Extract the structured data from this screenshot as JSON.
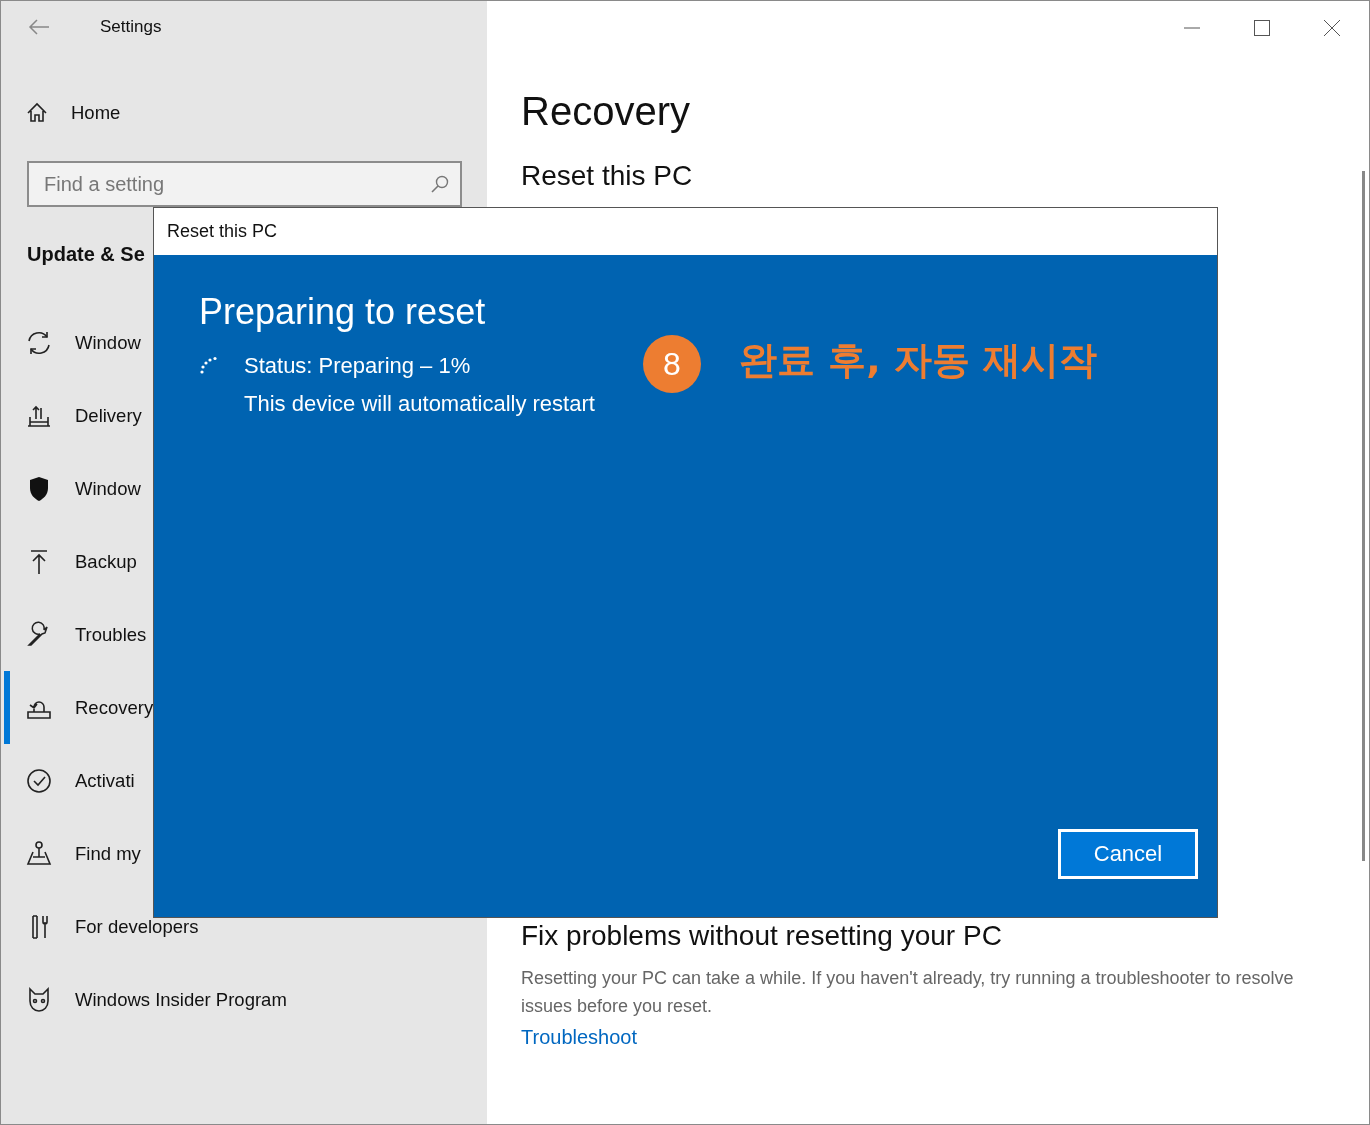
{
  "window": {
    "title": "Settings"
  },
  "sidebar": {
    "home": "Home",
    "search": {
      "placeholder": "Find a setting"
    },
    "section": "Update & Se",
    "items": [
      {
        "label": "Window",
        "selected": false
      },
      {
        "label": "Delivery",
        "selected": false
      },
      {
        "label": "Window",
        "selected": false
      },
      {
        "label": "Backup",
        "selected": false
      },
      {
        "label": "Troubles",
        "selected": false
      },
      {
        "label": "Recovery",
        "selected": true
      },
      {
        "label": "Activati",
        "selected": false
      },
      {
        "label": "Find my",
        "selected": false
      },
      {
        "label": "For developers",
        "selected": false
      },
      {
        "label": "Windows Insider Program",
        "selected": false
      }
    ]
  },
  "content": {
    "title": "Recovery",
    "section": "Reset this PC",
    "fix_heading": "Fix problems without resetting your PC",
    "fix_text": "Resetting your PC can take a while. If you haven't already, try running a troubleshooter to resolve issues before you reset.",
    "fix_link": "Troubleshoot"
  },
  "dialog": {
    "title": "Reset this PC",
    "heading": "Preparing to reset",
    "status": "Status: Preparing – 1%",
    "note": "This device will automatically restart",
    "button": "Cancel"
  },
  "annotation": {
    "step": "8",
    "text": "완료 후, 자동 재시작"
  }
}
